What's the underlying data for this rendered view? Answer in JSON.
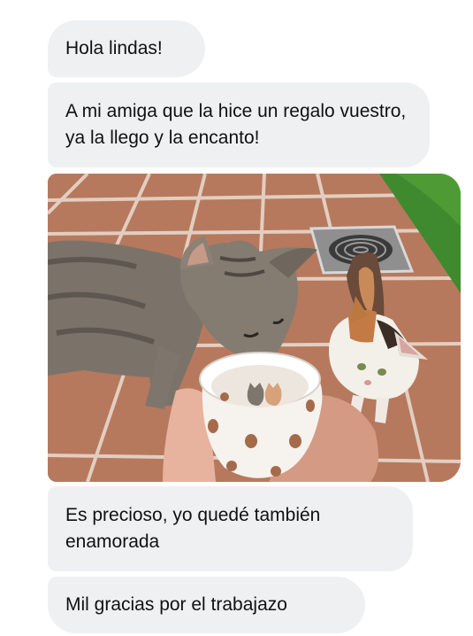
{
  "messages": [
    {
      "text": "Hola lindas!"
    },
    {
      "text": "A mi amiga que la hice un regalo vuestro, ya la llego y la encanto!"
    },
    {
      "text": "Es precioso, yo quedé también enamorada"
    },
    {
      "text": "Mil gracias por el trabajazo"
    }
  ],
  "colors": {
    "bubble": "#eff0f2",
    "text": "#111111",
    "tile": "#b77a5e",
    "grass": "#3f8a2e"
  }
}
